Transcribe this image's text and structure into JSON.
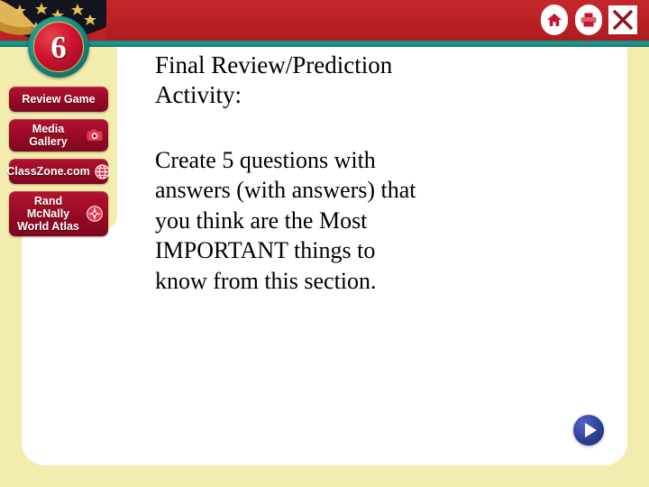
{
  "slide": {
    "chapter_number": "6",
    "heading": "Final Review/Prediction Activity:",
    "body": "Create 5 questions with answers (with answers) that you think are the Most IMPORTANT things to know from this section."
  },
  "banner": {
    "color": "#be2025",
    "accent_rule_color": "#1a8a80",
    "icons": [
      {
        "name": "home-icon",
        "label": "Home"
      },
      {
        "name": "print-icon",
        "label": "Print"
      },
      {
        "name": "close-icon",
        "label": "Close"
      }
    ]
  },
  "sidebar": {
    "background_color": "#f2edae",
    "button_color": "#9c0b27",
    "items": [
      {
        "label": "Review Game",
        "icon": ""
      },
      {
        "label": "Media Gallery",
        "icon": "camera-icon"
      },
      {
        "label": "ClassZone.com",
        "icon": "globe-icon"
      },
      {
        "label": "Rand McNally\nWorld Atlas",
        "icon": "compass-rose-icon"
      }
    ]
  },
  "navigation": {
    "next_label": "Next",
    "next_color": "#2f4096"
  }
}
